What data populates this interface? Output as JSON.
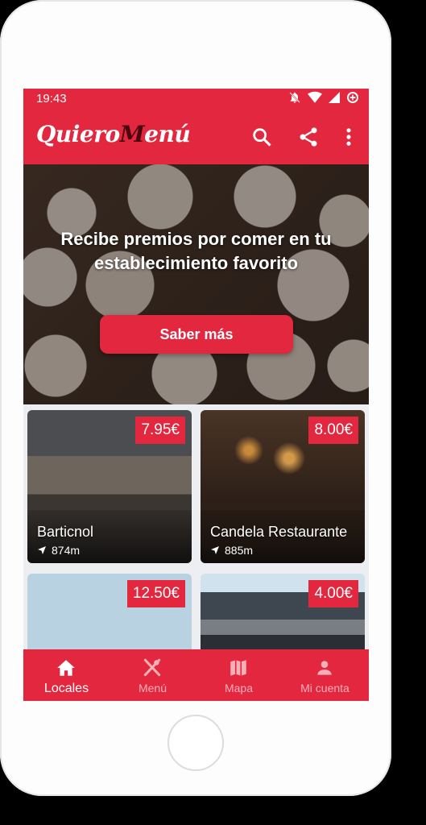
{
  "status_bar": {
    "time": "19:43"
  },
  "app_bar": {
    "logo_part1": "Quiero",
    "logo_part2": "M",
    "logo_part3": "enú",
    "actions": [
      "search-icon",
      "share-icon",
      "more-vert-icon"
    ]
  },
  "hero": {
    "title": "Recibe premios por comer en tu establecimiento favorito",
    "cta_label": "Saber más"
  },
  "cards": [
    {
      "name": "Barticnol",
      "distance": "874m",
      "price": "7.95€"
    },
    {
      "name": "Candela Restaurante",
      "distance": "885m",
      "price": "8.00€"
    },
    {
      "name": "",
      "distance": "",
      "price": "12.50€"
    },
    {
      "name": "",
      "distance": "",
      "price": "4.00€"
    }
  ],
  "bottom_nav": [
    {
      "label": "Locales",
      "icon": "home-icon",
      "active": true
    },
    {
      "label": "Menú",
      "icon": "utensils-icon",
      "active": false
    },
    {
      "label": "Mapa",
      "icon": "map-icon",
      "active": false
    },
    {
      "label": "Mi cuenta",
      "icon": "person-icon",
      "active": false
    }
  ],
  "colors": {
    "primary": "#e3273f",
    "logo_accent": "#4a0710"
  }
}
